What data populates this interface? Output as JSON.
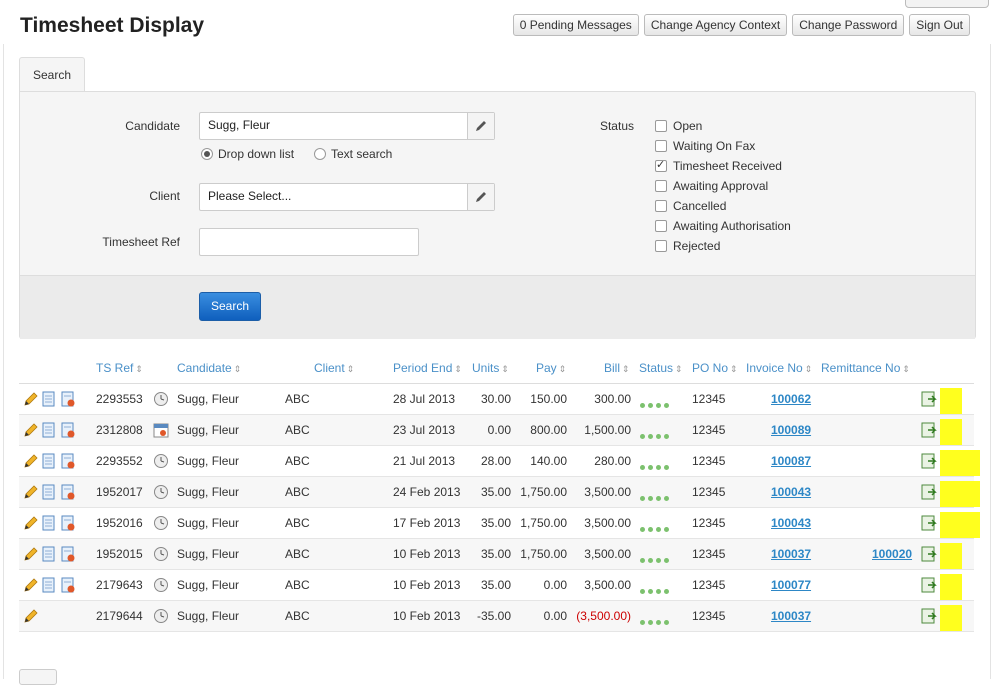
{
  "page_title": "Timesheet Display",
  "top_buttons": [
    "0 Pending Messages",
    "Change Agency Context",
    "Change Password",
    "Sign Out"
  ],
  "tab_label": "Search",
  "form": {
    "candidate_label": "Candidate",
    "candidate_value": "Sugg, Fleur",
    "radio_dropdown": "Drop down list",
    "radio_text": "Text search",
    "client_label": "Client",
    "client_value": "Please Select...",
    "ref_label": "Timesheet Ref",
    "ref_value": "",
    "status_label": "Status",
    "statuses": [
      {
        "label": "Open",
        "checked": false
      },
      {
        "label": "Waiting On Fax",
        "checked": false
      },
      {
        "label": "Timesheet Received",
        "checked": true
      },
      {
        "label": "Awaiting Approval",
        "checked": false
      },
      {
        "label": "Cancelled",
        "checked": false
      },
      {
        "label": "Awaiting Authorisation",
        "checked": false
      },
      {
        "label": "Rejected",
        "checked": false
      }
    ],
    "search_button": "Search"
  },
  "table": {
    "headers": [
      "TS Ref",
      "Candidate",
      "Client",
      "Period End",
      "Units",
      "Pay",
      "Bill",
      "Status",
      "PO No",
      "Invoice No",
      "Remittance No"
    ],
    "rows": [
      {
        "ref": "2293553",
        "candidate": "Sugg, Fleur",
        "client": "ABC",
        "period": "28 Jul 2013",
        "units": "30.00",
        "pay": "150.00",
        "bill": "300.00",
        "po": "12345",
        "invoice": "100062",
        "remit": "",
        "type": "clock",
        "full": true,
        "neg": false
      },
      {
        "ref": "2312808",
        "candidate": "Sugg, Fleur",
        "client": "ABC",
        "period": "23 Jul 2013",
        "units": "0.00",
        "pay": "800.00",
        "bill": "1,500.00",
        "po": "12345",
        "invoice": "100089",
        "remit": "",
        "type": "calendar",
        "full": true,
        "neg": false
      },
      {
        "ref": "2293552",
        "candidate": "Sugg, Fleur",
        "client": "ABC",
        "period": "21 Jul 2013",
        "units": "28.00",
        "pay": "140.00",
        "bill": "280.00",
        "po": "12345",
        "invoice": "100087",
        "remit": "",
        "type": "clock",
        "full": true,
        "neg": false
      },
      {
        "ref": "1952017",
        "candidate": "Sugg, Fleur",
        "client": "ABC",
        "period": "24 Feb 2013",
        "units": "35.00",
        "pay": "1,750.00",
        "bill": "3,500.00",
        "po": "12345",
        "invoice": "100043",
        "remit": "",
        "type": "clock",
        "full": true,
        "neg": false
      },
      {
        "ref": "1952016",
        "candidate": "Sugg, Fleur",
        "client": "ABC",
        "period": "17 Feb 2013",
        "units": "35.00",
        "pay": "1,750.00",
        "bill": "3,500.00",
        "po": "12345",
        "invoice": "100043",
        "remit": "",
        "type": "clock",
        "full": true,
        "neg": false
      },
      {
        "ref": "1952015",
        "candidate": "Sugg, Fleur",
        "client": "ABC",
        "period": "10 Feb 2013",
        "units": "35.00",
        "pay": "1,750.00",
        "bill": "3,500.00",
        "po": "12345",
        "invoice": "100037",
        "remit": "100020",
        "type": "clock",
        "full": true,
        "neg": false
      },
      {
        "ref": "2179643",
        "candidate": "Sugg, Fleur",
        "client": "ABC",
        "period": "10 Feb 2013",
        "units": "35.00",
        "pay": "0.00",
        "bill": "3,500.00",
        "po": "12345",
        "invoice": "100077",
        "remit": "",
        "type": "clock",
        "full": true,
        "neg": false
      },
      {
        "ref": "2179644",
        "candidate": "Sugg, Fleur",
        "client": "ABC",
        "period": "10 Feb 2013",
        "units": "-35.00",
        "pay": "0.00",
        "bill": "(3,500.00)",
        "po": "12345",
        "invoice": "100037",
        "remit": "",
        "type": "clock",
        "full": false,
        "neg": true
      }
    ]
  }
}
